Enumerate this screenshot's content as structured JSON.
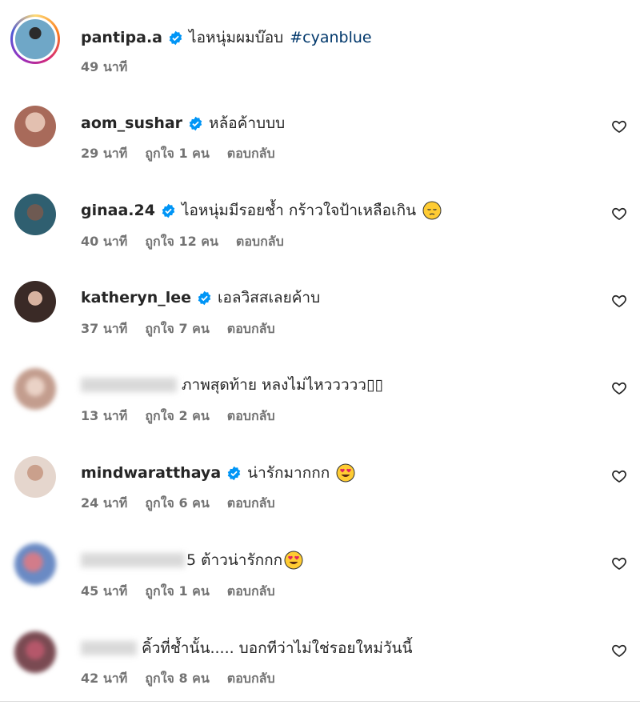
{
  "caption": {
    "username": "pantipa.a",
    "text": "ไอหนุ่มผมบ๊อบ",
    "hashtag": "#cyanblue",
    "time": "49 นาที"
  },
  "comments": [
    {
      "username": "aom_sushar",
      "verified": true,
      "text": "หล้อค้าบบบ",
      "time": "29 นาที",
      "likes": "ถูกใจ 1 คน",
      "reply": "ตอบกลับ",
      "avatar_color": "#c99a8a"
    },
    {
      "username": "ginaa.24",
      "verified": true,
      "text": "ไอหนุ่มมีรอยช้ำ กร้าวใจป้าเหลือเกิน",
      "emoji": "pensive-face",
      "time": "40 นาที",
      "likes": "ถูกใจ 12 คน",
      "reply": "ตอบกลับ",
      "avatar_color": "#3e6b7a"
    },
    {
      "username": "katheryn_lee",
      "verified": true,
      "text": "เอลวิสสเลยค้าบ",
      "time": "37 นาที",
      "likes": "ถูกใจ 7 คน",
      "reply": "ตอบกลับ",
      "avatar_color": "#4a3a36"
    },
    {
      "username": "",
      "verified": false,
      "text": "ภาพสุดท้าย หลงไม่ไหววววว▯▯",
      "time": "13 นาที",
      "likes": "ถูกใจ 2 คน",
      "reply": "ตอบกลับ",
      "avatar_color": "#cfb2a6"
    },
    {
      "username": "mindwaratthaya",
      "verified": true,
      "text": "น่ารักมากกก",
      "emoji": "heart-eyes-face",
      "time": "24 นาที",
      "likes": "ถูกใจ 6 คน",
      "reply": "ตอบกลับ",
      "avatar_color": "#d8c0b4"
    },
    {
      "username": "",
      "verified": false,
      "text": "5 ต้าวน่ารักกก",
      "emoji": "heart-eyes-face",
      "time": "45 นาที",
      "likes": "ถูกใจ 1 คน",
      "reply": "ตอบกลับ",
      "avatar_color": "#8a7aa8"
    },
    {
      "username": "",
      "verified": false,
      "text": "คิ้วที่ช้ำนั้น..... บอกทีว่าไม่ใช่รอยใหม่วันนี้",
      "time": "42 นาที",
      "likes": "ถูกใจ 8 คน",
      "reply": "ตอบกลับ",
      "avatar_color": "#9a6a6e"
    }
  ],
  "colors": {
    "verified": "#0095f6",
    "hashtag": "#00376b",
    "meta": "#737373"
  }
}
